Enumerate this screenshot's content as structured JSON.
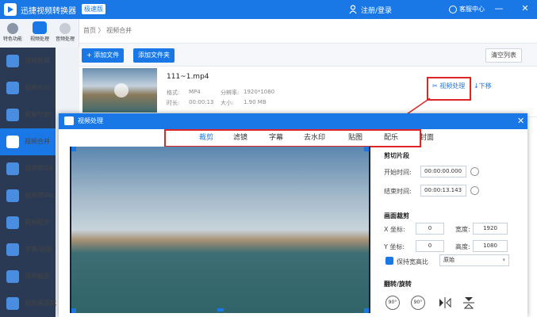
{
  "app": {
    "title": "迅捷视频转换器",
    "badge": "极速版",
    "login": "注册/登录",
    "service": "客服中心",
    "minimize": "—",
    "close": "✕"
  },
  "topnav": [
    {
      "label": "特色功能"
    },
    {
      "label": "视频处理"
    },
    {
      "label": "音频处理"
    }
  ],
  "sidebar": {
    "items": [
      {
        "label": "视频剪辑"
      },
      {
        "label": "视频水印"
      },
      {
        "label": "视频分割"
      },
      {
        "label": "视频合并"
      },
      {
        "label": "视频转Gif"
      },
      {
        "label": "视频转We"
      },
      {
        "label": "视频配乐"
      },
      {
        "label": "字幕/贴图"
      },
      {
        "label": "视频截图"
      },
      {
        "label": "视频画面裁"
      }
    ],
    "active_index": 3
  },
  "breadcrumb": "首页 〉 视频合并",
  "toolbar": {
    "add_file": "+ 添加文件",
    "add_folder": "添加文件夹",
    "clear": "清空列表"
  },
  "file": {
    "name": "111~1.mp4",
    "format_label": "格式:",
    "format": "MP4",
    "resolution_label": "分辨率:",
    "resolution": "1920*1080",
    "duration_label": "时长:",
    "duration": "00:00:13",
    "size_label": "大小:",
    "size": "1.90 MB",
    "process_link": "视频处理",
    "down_link": "下移"
  },
  "dialog": {
    "title": "视频处理",
    "close": "✕",
    "tabs": [
      {
        "label": "裁剪"
      },
      {
        "label": "滤镜"
      },
      {
        "label": "字幕"
      },
      {
        "label": "去水印"
      },
      {
        "label": "贴图"
      },
      {
        "label": "配乐"
      },
      {
        "label": "封面"
      }
    ],
    "active_tab": 0
  },
  "clip": {
    "title": "剪切片段",
    "start_label": "开始时间:",
    "start": "00:00:00.000",
    "end_label": "结束时间:",
    "end": "00:00:13.143"
  },
  "crop": {
    "title": "画面裁剪",
    "x_label": "X 坐标:",
    "x": "0",
    "width_label": "宽度:",
    "width": "1920",
    "y_label": "Y 坐标:",
    "y": "0",
    "height_label": "高度:",
    "height": "1080",
    "keep_ratio_label": "保持宽高比",
    "ratio": "原始"
  },
  "rotate": {
    "title": "翻转/旋转",
    "left90": "90°",
    "right90": "90°"
  },
  "colors": {
    "accent": "#1a78e6",
    "annotation": "#e02525"
  }
}
